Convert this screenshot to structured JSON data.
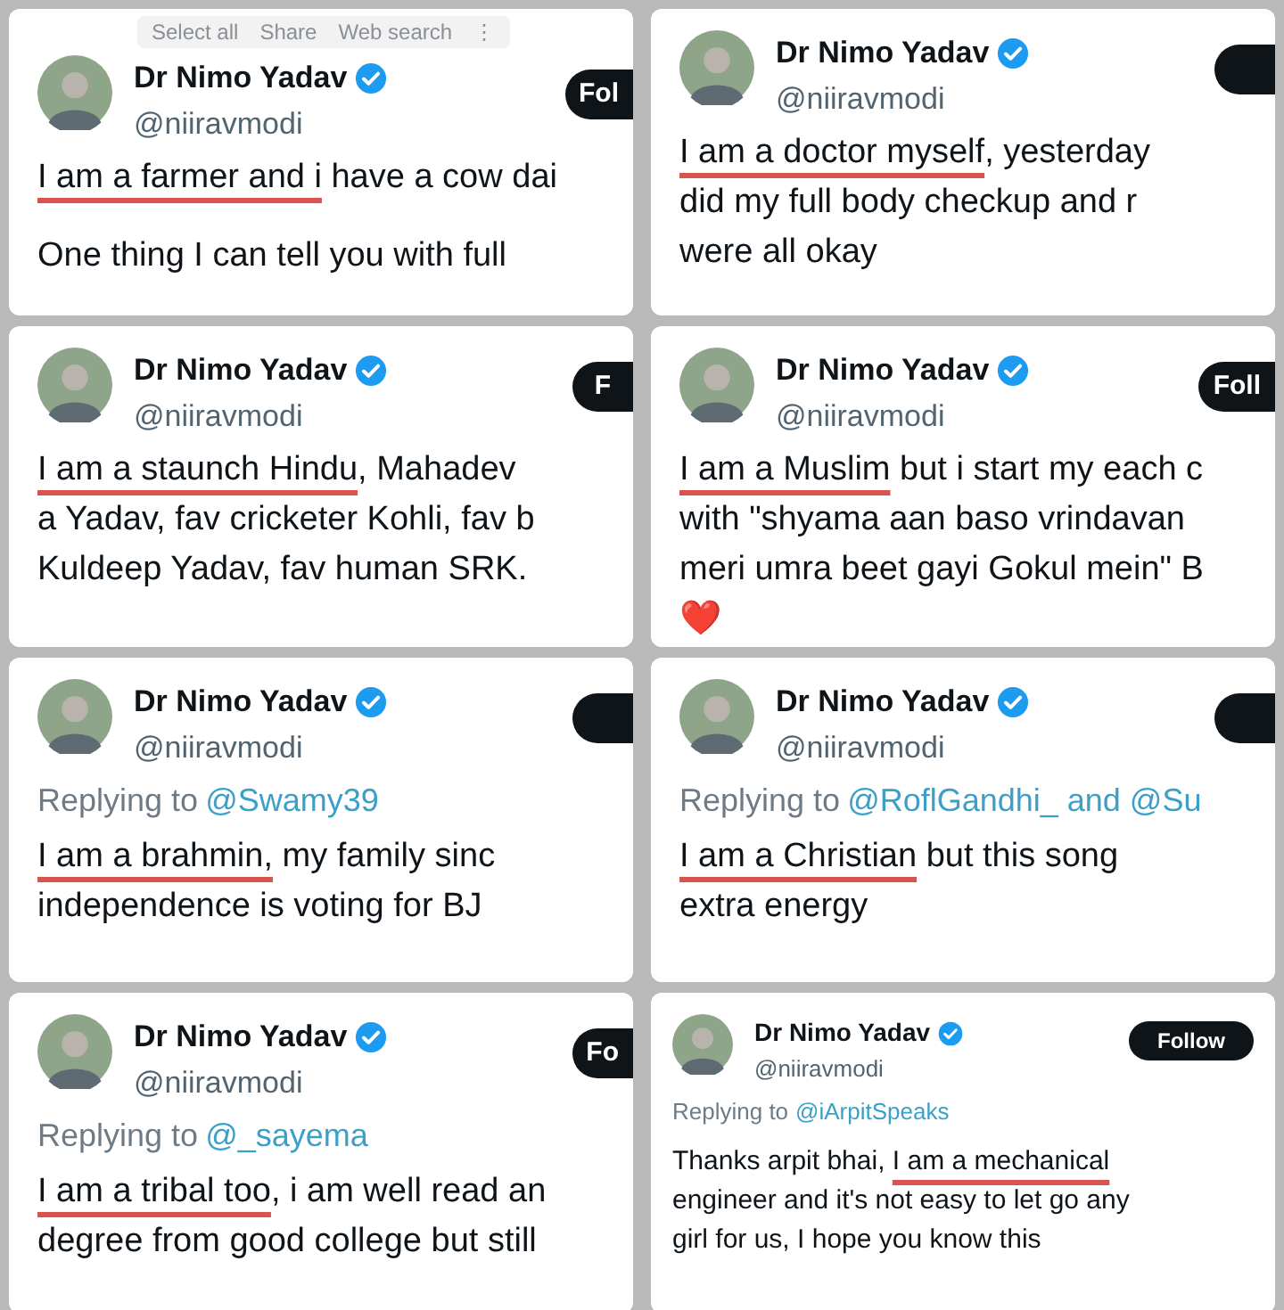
{
  "tweets": [
    {
      "name": "Dr Nimo Yadav",
      "handle": "@niiravmodi",
      "follow_label": "Fol",
      "kind": "regular",
      "selection_toolbar": [
        "Select all",
        "Share",
        "Web search",
        "⋮"
      ],
      "paragraphs": [
        [
          {
            "marked": "I am a farmer and i",
            "text": " have a cow dai"
          }
        ],
        [
          {
            "text": "One thing I can tell you with full"
          }
        ]
      ]
    },
    {
      "name": "Dr Nimo Yadav",
      "handle": "@niiravmodi",
      "kind": "regular",
      "paragraphs": [
        [
          {
            "marked": "I am a doctor myself",
            "text": ", yesterday"
          },
          {
            "text": "did my full body checkup and r"
          },
          {
            "text": "were all okay"
          }
        ]
      ]
    },
    {
      "name": "Dr Nimo Yadav",
      "handle": "@niiravmodi",
      "follow_label": "F",
      "kind": "regular",
      "paragraphs": [
        [
          {
            "marked": "I am a staunch Hindu",
            "text": ", Mahadev"
          },
          {
            "text": "a Yadav, fav cricketer Kohli, fav b"
          },
          {
            "text": "Kuldeep Yadav, fav human SRK."
          }
        ]
      ]
    },
    {
      "name": "Dr Nimo Yadav",
      "handle": "@niiravmodi",
      "follow_label": "Foll",
      "kind": "regular",
      "paragraphs": [
        [
          {
            "marked": "I am a Muslim",
            "text": " but i start my each c"
          },
          {
            "text": "with \"shyama aan baso vrindavan"
          },
          {
            "text": "meri umra beet gayi Gokul mein\" B"
          },
          {
            "text": "❤️"
          }
        ]
      ]
    },
    {
      "name": "Dr Nimo Yadav",
      "handle": "@niiravmodi",
      "kind": "regular",
      "replying_to": "Replying to",
      "mentions": "@Swamy39",
      "paragraphs": [
        [
          {
            "marked": "I am a brahmin,",
            "text": " my family sinc"
          },
          {
            "text": "independence is voting for BJ"
          }
        ]
      ]
    },
    {
      "name": "Dr Nimo Yadav",
      "handle": "@niiravmodi",
      "kind": "regular",
      "replying_to": "Replying to",
      "mentions": "@RoflGandhi_ and @Su",
      "paragraphs": [
        [
          {
            "marked": "I am a Christian",
            "text": " but this song"
          },
          {
            "text": "extra energy"
          }
        ]
      ]
    },
    {
      "name": "Dr Nimo Yadav",
      "handle": "@niiravmodi",
      "follow_label": "Fo",
      "kind": "regular",
      "replying_to": "Replying to",
      "mentions": "@_sayema",
      "paragraphs": [
        [
          {
            "marked": "I am a tribal too",
            "text": ", i am well read an"
          },
          {
            "text": "degree from good college but still"
          }
        ]
      ]
    },
    {
      "name": "Dr Nimo Yadav",
      "handle": "@niiravmodi",
      "follow_label": "Follow",
      "kind": "compact",
      "replying_to": "Replying to",
      "mentions": "@iArpitSpeaks",
      "paragraphs": [
        [
          {
            "text": "Thanks arpit bhai, ",
            "marked_after": "I am a mechanical"
          },
          {
            "text": "engineer and it's not easy to let go any"
          },
          {
            "text": "girl  for us, I hope you know this"
          }
        ]
      ]
    }
  ]
}
